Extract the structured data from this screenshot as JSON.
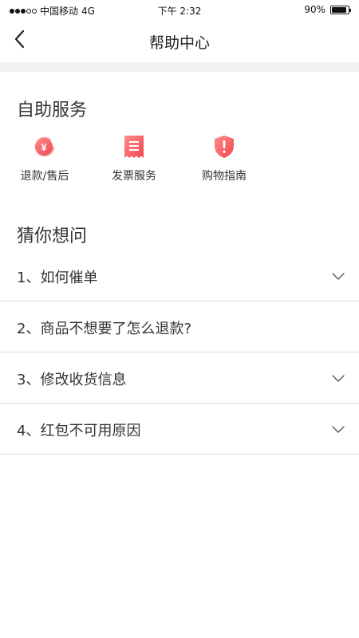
{
  "status_bar": {
    "carrier": "中国移动",
    "network": "4G",
    "time": "下午 2:32",
    "battery_text": "90%",
    "battery_level": 0.9
  },
  "nav": {
    "title": "帮助中心",
    "back_icon": "chevron-left-icon"
  },
  "self_service": {
    "title": "自助服务",
    "items": [
      {
        "label": "退款/售后",
        "icon": "refund-yen-icon"
      },
      {
        "label": "发票服务",
        "icon": "invoice-receipt-icon"
      },
      {
        "label": "购物指南",
        "icon": "shopping-guide-shield-icon"
      }
    ]
  },
  "faq": {
    "title": "猜你想问",
    "items": [
      {
        "text": "1、如何催单",
        "expandable": true
      },
      {
        "text": "2、商品不想要了怎么退款?",
        "expandable": false
      },
      {
        "text": "3、修改收货信息",
        "expandable": true
      },
      {
        "text": "4、红包不可用原因",
        "expandable": true
      }
    ]
  },
  "colors": {
    "accent": "#f0474d",
    "accent_light": "#ff8a8d",
    "divider": "#dddddd",
    "band": "#f2f2f2",
    "text": "#333333"
  }
}
